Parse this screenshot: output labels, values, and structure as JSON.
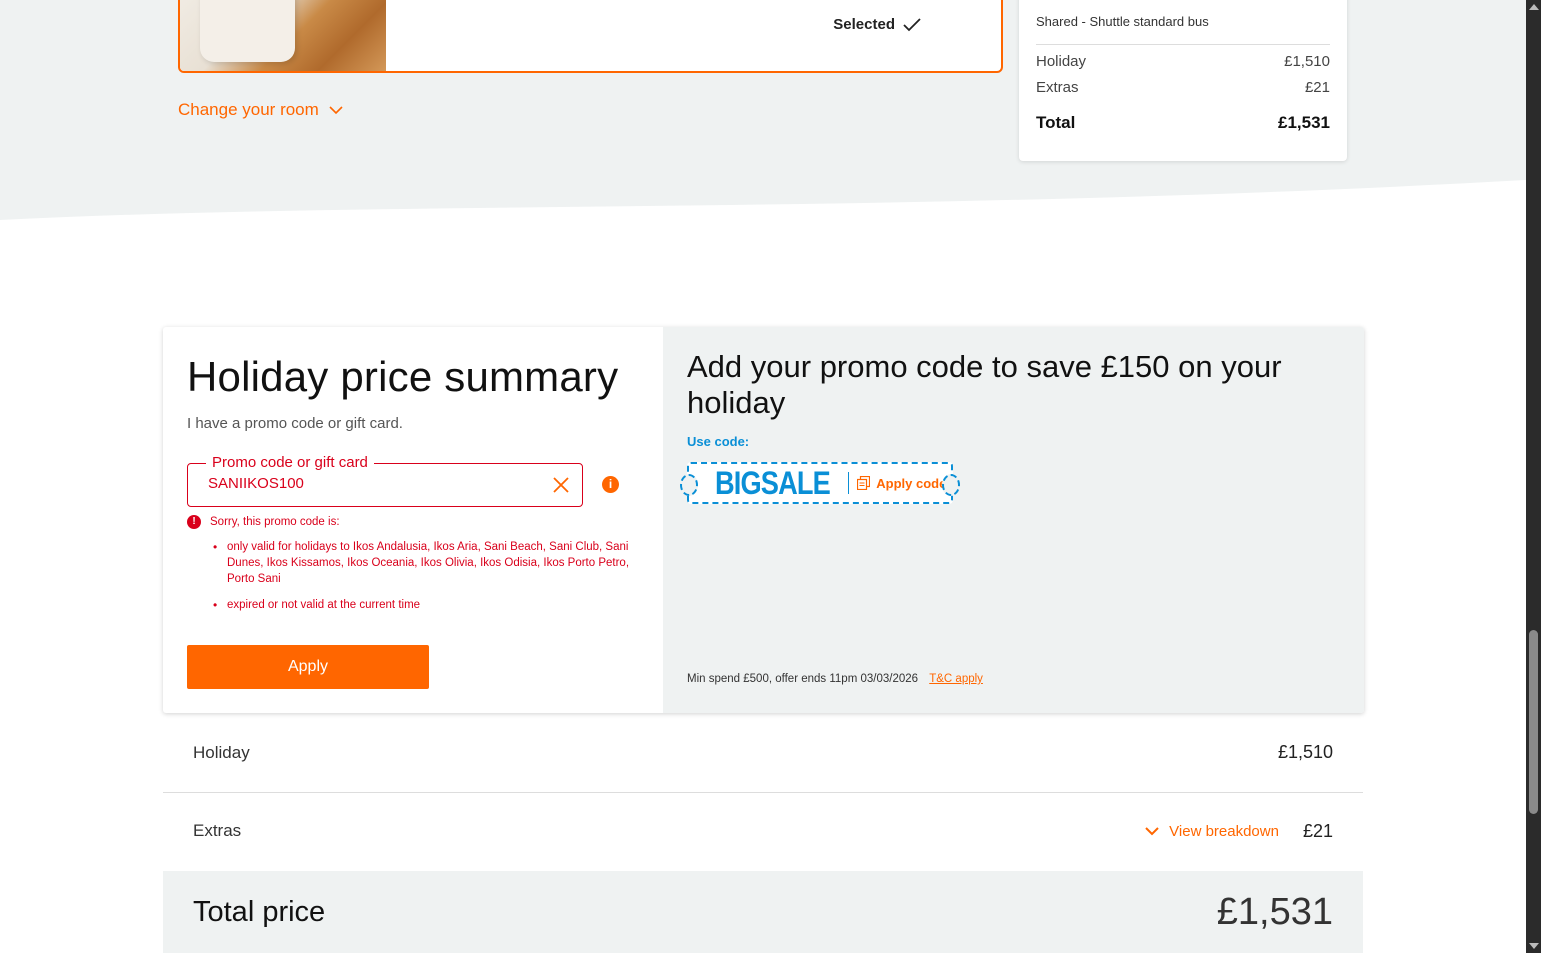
{
  "room": {
    "selected_label": "Selected",
    "change_room_label": "Change your room"
  },
  "side_summary": {
    "transfer": "Shared - Shuttle standard bus",
    "holiday_label": "Holiday",
    "holiday_value": "£1,510",
    "extras_label": "Extras",
    "extras_value": "£21",
    "total_label": "Total",
    "total_value": "£1,531"
  },
  "summary": {
    "title": "Holiday price summary",
    "promo_question": "I have a promo code or gift card.",
    "promo_field_label": "Promo code or gift card",
    "promo_value": "SANIIKOS100",
    "info_glyph": "i",
    "error_heading": "Sorry, this promo code is:",
    "errors": [
      "only valid for holidays to Ikos Andalusia, Ikos Aria, Sani Beach, Sani Club, Sani Dunes, Ikos Kissamos, Ikos Oceania, Ikos Olivia, Ikos Odisia, Ikos Porto Petro, Porto Sani",
      "expired or not valid at the current time"
    ],
    "apply_label": "Apply"
  },
  "promo_offer": {
    "headline": "Add your promo code to save £150 on your holiday",
    "use_code_label": "Use code:",
    "code": "BIGSALE",
    "apply_code_label": "Apply code",
    "min_spend": "Min spend £500, offer ends 11pm 03/03/2026",
    "tc_link": "T&C apply"
  },
  "breakdown": {
    "holiday_label": "Holiday",
    "holiday_value": "£1,510",
    "extras_label": "Extras",
    "view_breakdown_label": "View breakdown",
    "extras_value": "£21",
    "total_label": "Total price",
    "total_value": "£1,531"
  },
  "colors": {
    "accent": "#ff6600",
    "error": "#d9001b",
    "promo_blue": "#0a8fd6",
    "panel_grey": "#eff2f2"
  }
}
